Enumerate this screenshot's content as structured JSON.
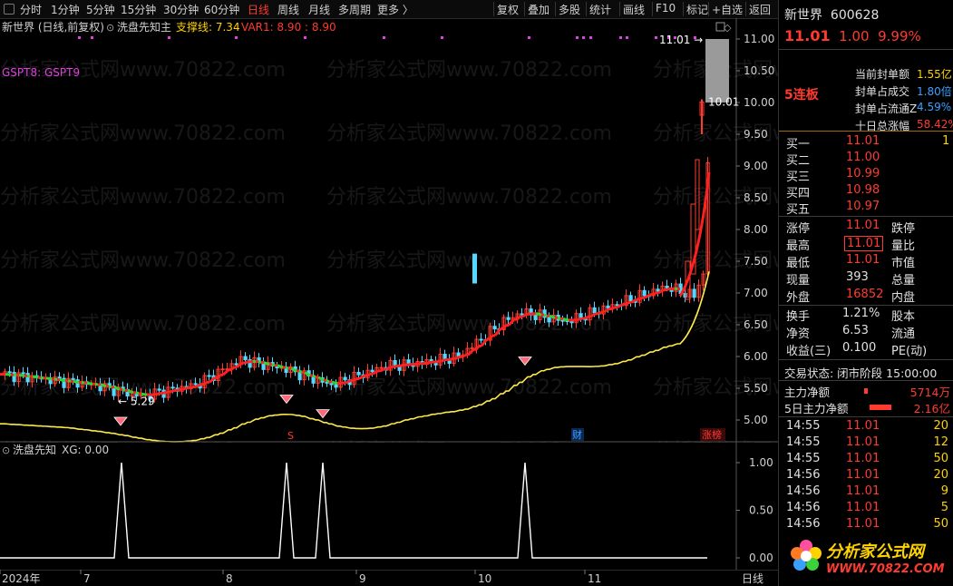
{
  "toolbar": {
    "timeframes": [
      "分时",
      "1分钟",
      "5分钟",
      "15分钟",
      "30分钟",
      "60分钟",
      "日线",
      "周线",
      "月线",
      "多周期",
      "更多 〉"
    ],
    "active": "日线",
    "tools": [
      "复权",
      "叠加",
      "多股",
      "统计",
      "画线",
      "F10",
      "标记",
      "+自选",
      "返回"
    ]
  },
  "header": {
    "stock_label": "新世界 (日线,前复权)",
    "indicator": "洗盘先知主",
    "support": "支撑线: 7.34",
    "var1": "VAR1: 8.90 : 8.90",
    "gspt": "GSPT8: GSPT9"
  },
  "main": {
    "price_ticks": [
      "11.00",
      "10.50",
      "10.00",
      "9.50",
      "9.00",
      "8.50",
      "8.00",
      "7.50",
      "7.00",
      "6.50",
      "6.00",
      "5.50",
      "5.00"
    ],
    "low_label": "← 5.29",
    "high_label": "11.01 →",
    "last_label": "10.01",
    "markers": {
      "s": "S",
      "cai": "财",
      "zhangbang": "涨榜"
    }
  },
  "sub": {
    "title": "洗盘先知",
    "xg": "XG: 0.00",
    "ticks": [
      "1.00",
      "0.50",
      "0.00"
    ]
  },
  "xaxis": {
    "labels": [
      "2024年",
      "7",
      "8",
      "9",
      "10",
      "11"
    ],
    "right": "日线"
  },
  "watermark": "分析家公式网www.70822.com",
  "panel": {
    "name": "新世界",
    "code": "600628",
    "price": "11.01",
    "change": "1.00",
    "pct": "9.99%",
    "lianban": "5连板",
    "seal": [
      {
        "k": "当前封单额",
        "v": "1.55亿"
      },
      {
        "k": "封单占成交",
        "v": "1.80倍"
      },
      {
        "k": "封单占流通Z",
        "v": "4.59%"
      },
      {
        "k": "十日总涨幅",
        "v": "58.42%"
      }
    ],
    "buy": [
      {
        "k": "买一",
        "v": "11.01",
        "q": "1"
      },
      {
        "k": "买二",
        "v": "11.00",
        "q": ""
      },
      {
        "k": "买三",
        "v": "10.99",
        "q": ""
      },
      {
        "k": "买四",
        "v": "10.98",
        "q": ""
      },
      {
        "k": "买五",
        "v": "10.97",
        "q": ""
      }
    ],
    "stats": [
      {
        "k1": "涨停",
        "v1": "11.01",
        "k2": "跌停"
      },
      {
        "k1": "最高",
        "v1": "11.01",
        "k2": "量比"
      },
      {
        "k1": "最低",
        "v1": "11.01",
        "k2": "市值"
      },
      {
        "k1": "现量",
        "v1": "393",
        "k2": "总量"
      },
      {
        "k1": "外盘",
        "v1": "16852",
        "k2": "内盘"
      }
    ],
    "stats2": [
      {
        "k1": "换手",
        "v1": "1.21%",
        "k2": "股本"
      },
      {
        "k1": "净资",
        "v1": "6.53",
        "k2": "流通"
      },
      {
        "k1": "收益(三)",
        "v1": "0.100",
        "k2": "PE(动)"
      }
    ],
    "status": "交易状态: 闭市阶段 15:00:00",
    "net": {
      "k": "主力净额",
      "v": "5714万"
    },
    "net5": {
      "k": "5日主力净额",
      "v": "2.16亿"
    },
    "ticks": [
      {
        "t": "14:55",
        "p": "11.01",
        "v": "20"
      },
      {
        "t": "14:55",
        "p": "11.01",
        "v": "12"
      },
      {
        "t": "14:55",
        "p": "11.01",
        "v": "50"
      },
      {
        "t": "14:56",
        "p": "11.01",
        "v": "20"
      },
      {
        "t": "14:56",
        "p": "11.01",
        "v": "9"
      },
      {
        "t": "14:56",
        "p": "11.01",
        "v": "5"
      },
      {
        "t": "14:56",
        "p": "11.01",
        "v": "50"
      }
    ],
    "logo_title": "分析家公式网",
    "logo_url": "WWW.70822.COM"
  }
}
